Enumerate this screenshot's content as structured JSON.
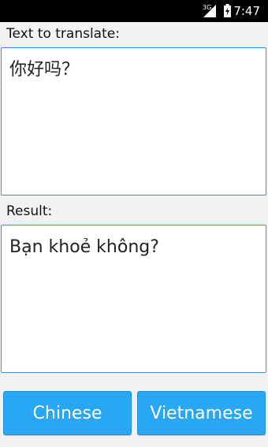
{
  "status_bar": {
    "network": "3G",
    "time": "7:47"
  },
  "source": {
    "label": "Text to translate:",
    "text": "你好吗？"
  },
  "result": {
    "label": "Result:",
    "text": "Bạn khoẻ không?"
  },
  "buttons": {
    "source_language": "Chinese",
    "target_language": "Vietnamese"
  },
  "colors": {
    "accent": "#2aa7f3",
    "box_border": "#3b8fe6",
    "background": "#f2f2f2"
  }
}
